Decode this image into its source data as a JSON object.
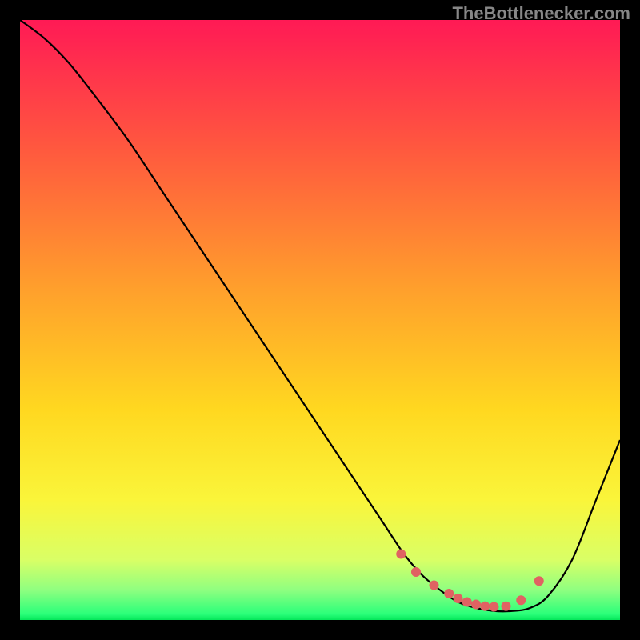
{
  "watermark": "TheBottlenecker.com",
  "chart_data": {
    "type": "line",
    "title": "",
    "xlabel": "",
    "ylabel": "",
    "xlim": [
      0,
      100
    ],
    "ylim": [
      0,
      100
    ],
    "gradient_stops": [
      {
        "offset": 0,
        "color": "#ff1a55"
      },
      {
        "offset": 22,
        "color": "#ff5a3e"
      },
      {
        "offset": 45,
        "color": "#ffa02c"
      },
      {
        "offset": 65,
        "color": "#ffd820"
      },
      {
        "offset": 80,
        "color": "#faf53a"
      },
      {
        "offset": 90,
        "color": "#d9ff66"
      },
      {
        "offset": 95,
        "color": "#8fff80"
      },
      {
        "offset": 99,
        "color": "#2bff7a"
      },
      {
        "offset": 100,
        "color": "#04e65a"
      }
    ],
    "series": [
      {
        "name": "bottleneck-curve",
        "color": "#000000",
        "x": [
          0,
          4,
          8,
          12,
          18,
          24,
          30,
          36,
          42,
          48,
          54,
          60,
          64,
          67,
          70,
          73,
          76,
          79,
          82,
          85,
          88,
          92,
          96,
          100
        ],
        "y": [
          100,
          97,
          93,
          88,
          80,
          71,
          62,
          53,
          44,
          35,
          26,
          17,
          11,
          7.5,
          5,
          3,
          2,
          1.5,
          1.5,
          2,
          4,
          10,
          20,
          30
        ]
      }
    ],
    "markers": {
      "name": "optimal-range-dots",
      "color": "#e06262",
      "radius": 6,
      "x": [
        63.5,
        66,
        69,
        71.5,
        73,
        74.5,
        76,
        77.5,
        79,
        81,
        83.5,
        86.5
      ],
      "y": [
        11,
        8,
        5.8,
        4.4,
        3.6,
        3,
        2.6,
        2.3,
        2.2,
        2.3,
        3.3,
        6.5
      ]
    }
  }
}
